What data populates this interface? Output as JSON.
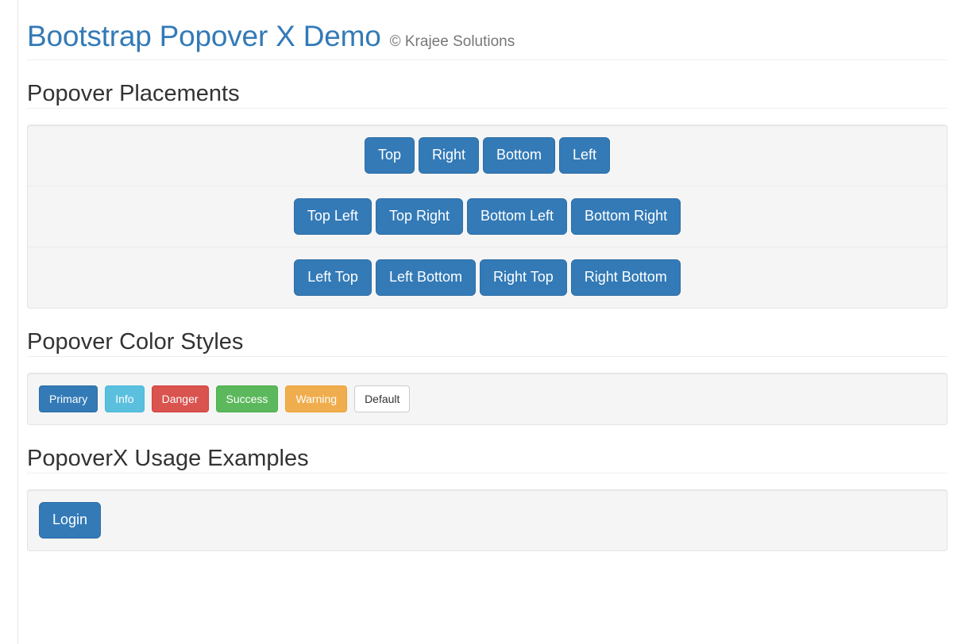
{
  "masthead": {
    "title": "Bootstrap Popover X Demo",
    "subtitle": "© Krajee Solutions"
  },
  "colors": {
    "brand": "#337ab7",
    "primary": "#337ab7",
    "info": "#5bc0de",
    "danger": "#d9534f",
    "success": "#5cb85c",
    "warning": "#f0ad4e",
    "default_bg": "#ffffff",
    "panel_bg": "#f5f5f5",
    "heading": "#333333",
    "subtitle": "#777777"
  },
  "sections": [
    {
      "id": "placements",
      "heading": "Popover Placements",
      "rows": [
        {
          "buttons": [
            {
              "label": "Top",
              "style": "primary"
            },
            {
              "label": "Right",
              "style": "primary"
            },
            {
              "label": "Bottom",
              "style": "primary"
            },
            {
              "label": "Left",
              "style": "primary"
            }
          ]
        },
        {
          "buttons": [
            {
              "label": "Top Left",
              "style": "primary"
            },
            {
              "label": "Top Right",
              "style": "primary"
            },
            {
              "label": "Bottom Left",
              "style": "primary"
            },
            {
              "label": "Bottom Right",
              "style": "primary"
            }
          ]
        },
        {
          "buttons": [
            {
              "label": "Left Top",
              "style": "primary"
            },
            {
              "label": "Left Bottom",
              "style": "primary"
            },
            {
              "label": "Right Top",
              "style": "primary"
            },
            {
              "label": "Right Bottom",
              "style": "primary"
            }
          ]
        }
      ]
    },
    {
      "id": "color-styles",
      "heading": "Popover Color Styles",
      "rows": [
        {
          "buttons": [
            {
              "label": "Primary",
              "style": "primary"
            },
            {
              "label": "Info",
              "style": "info"
            },
            {
              "label": "Danger",
              "style": "danger"
            },
            {
              "label": "Success",
              "style": "success"
            },
            {
              "label": "Warning",
              "style": "warning"
            },
            {
              "label": "Default",
              "style": "default"
            }
          ]
        }
      ]
    },
    {
      "id": "usage-examples",
      "heading": "PopoverX Usage Examples",
      "rows": [
        {
          "buttons": [
            {
              "label": "Login",
              "style": "primary"
            }
          ]
        }
      ]
    }
  ]
}
